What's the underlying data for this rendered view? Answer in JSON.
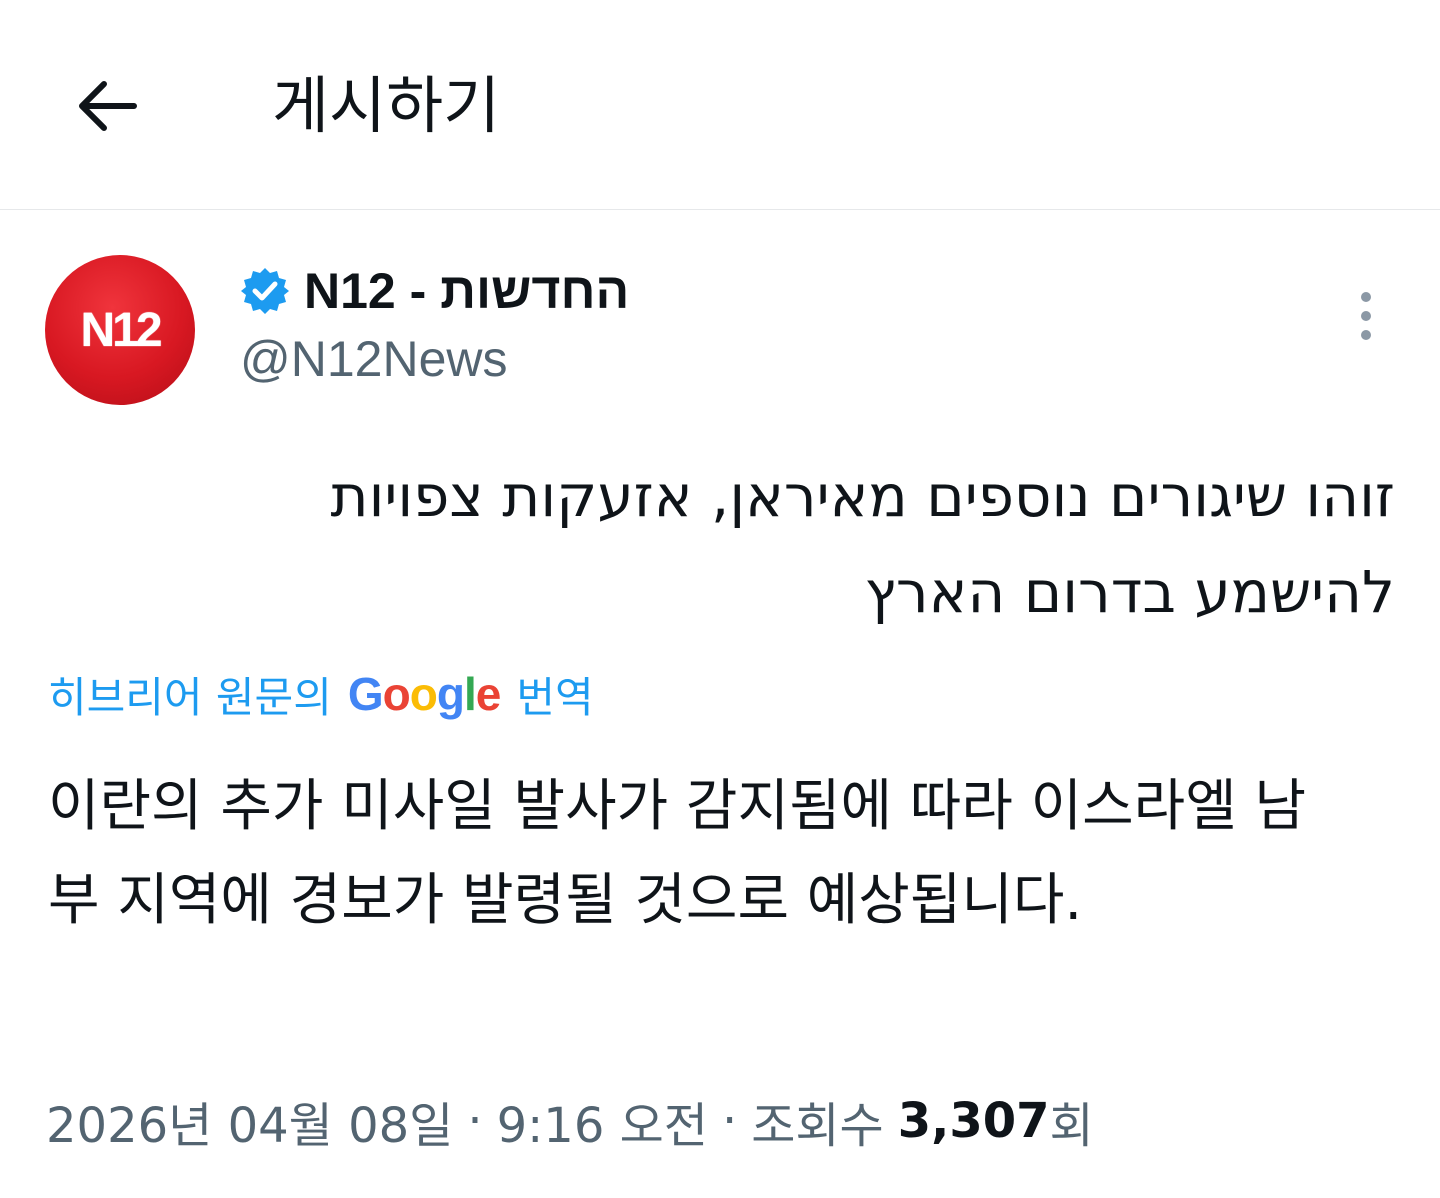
{
  "header": {
    "title": "게시하기",
    "back_icon": "arrow-left-icon"
  },
  "post": {
    "avatar_text": "N12",
    "display_name": "החדשות - N12",
    "handle": "@N12News",
    "verified_icon": "verified-badge-icon",
    "verified_color": "#1d9bf0",
    "more_icon": "more-vertical-icon",
    "text": "זוהו שיגורים נוספים מאיראן, אזעקות צפויות להישמע בדרום הארץ",
    "translate": {
      "prefix": "히브리어 원문의",
      "google": "Google",
      "suffix": "번역"
    },
    "translated_text": "이란의 추가 미사일 발사가 감지됨에 따라 이스라엘 남부 지역에 경보가 발령될 것으로 예상됩니다.",
    "meta": {
      "date": "2026년 04월 08일",
      "separator": "·",
      "time": "9:16 오전",
      "views_label": "조회수",
      "views_count": "3,307",
      "views_suffix": "회"
    }
  },
  "colors": {
    "brand_red": "#d81822",
    "link_blue": "#1d9bf0",
    "secondary_text": "#536471"
  }
}
